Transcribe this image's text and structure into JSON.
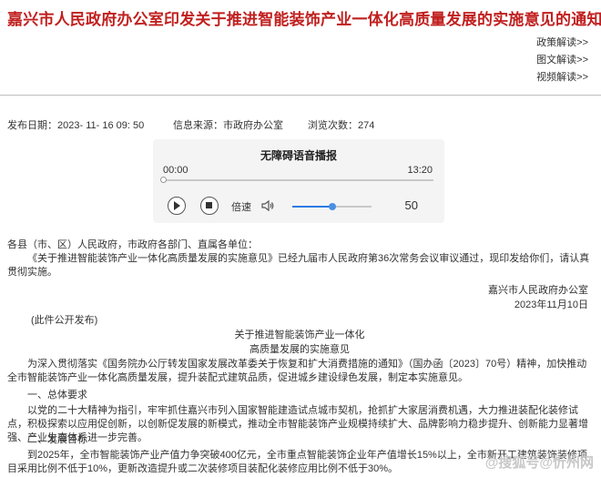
{
  "title": "嘉兴市人民政府办公室印发关于推进智能装饰产业一体化高质量发展的实施意见的通知",
  "side_links": [
    "政策解读>>",
    "图文解读>>",
    "视频解读>>"
  ],
  "meta": {
    "publish_date": "发布日期：2023- 11- 16 09: 50",
    "source": "信息来源：市政府办公室",
    "views": "浏览次数：274"
  },
  "player": {
    "title": "无障碍语音播报",
    "current_time": "00:00",
    "total_time": "13:20",
    "speed_label": "倍速",
    "volume": "50",
    "volume_level": 0.5
  },
  "doc": {
    "recipients": "各县（市、区）人民政府，市政府各部门、直属各单位：",
    "intro": "《关于推进智能装饰产业一体化高质量发展的实施意见》已经九届市人民政府第36次常务会议审议通过，现印发给你们，请认真贯彻实施。",
    "signature": "嘉兴市人民政府办公室",
    "date": "2023年11月10日",
    "public_note": "(此件公开发布)",
    "heading1": "关于推进智能装饰产业一体化",
    "heading2": "高质量发展的实施意见",
    "para1": "为深入贯彻落实《国务院办公厅转发国家发展改革委关于恢复和扩大消费措施的通知》（国办函〔2023〕70号）精神，加快推动全市智能装饰产业一体化高质量发展，提升装配式建筑品质，促进城乡建设绿色发展，制定本实施意见。",
    "section1": "一、总体要求",
    "para2": "以党的二十大精神为指引，牢牢抓住嘉兴市列入国家智能建造试点城市契机，抢抓扩大家居消费机遇，大力推进装配化装修试点，积极探索以应用促创新，以创新促发展的新模式，推动全市智能装饰产业规模持续扩大、品牌影响力稳步提升、创新能力显著增强、产业生态体系进一步完善。",
    "section2": "二、发展目标",
    "para3": "到2025年，全市智能装饰产业产值力争突破400亿元，全市重点智能装饰企业年产值增长15%以上，全市新开工建筑装饰装修项目采用比例不低于10%，更新改造提升或二次装修项目装配化装修应用比例不低于30%。"
  },
  "watermark": "@搜狐号@忻州网"
}
